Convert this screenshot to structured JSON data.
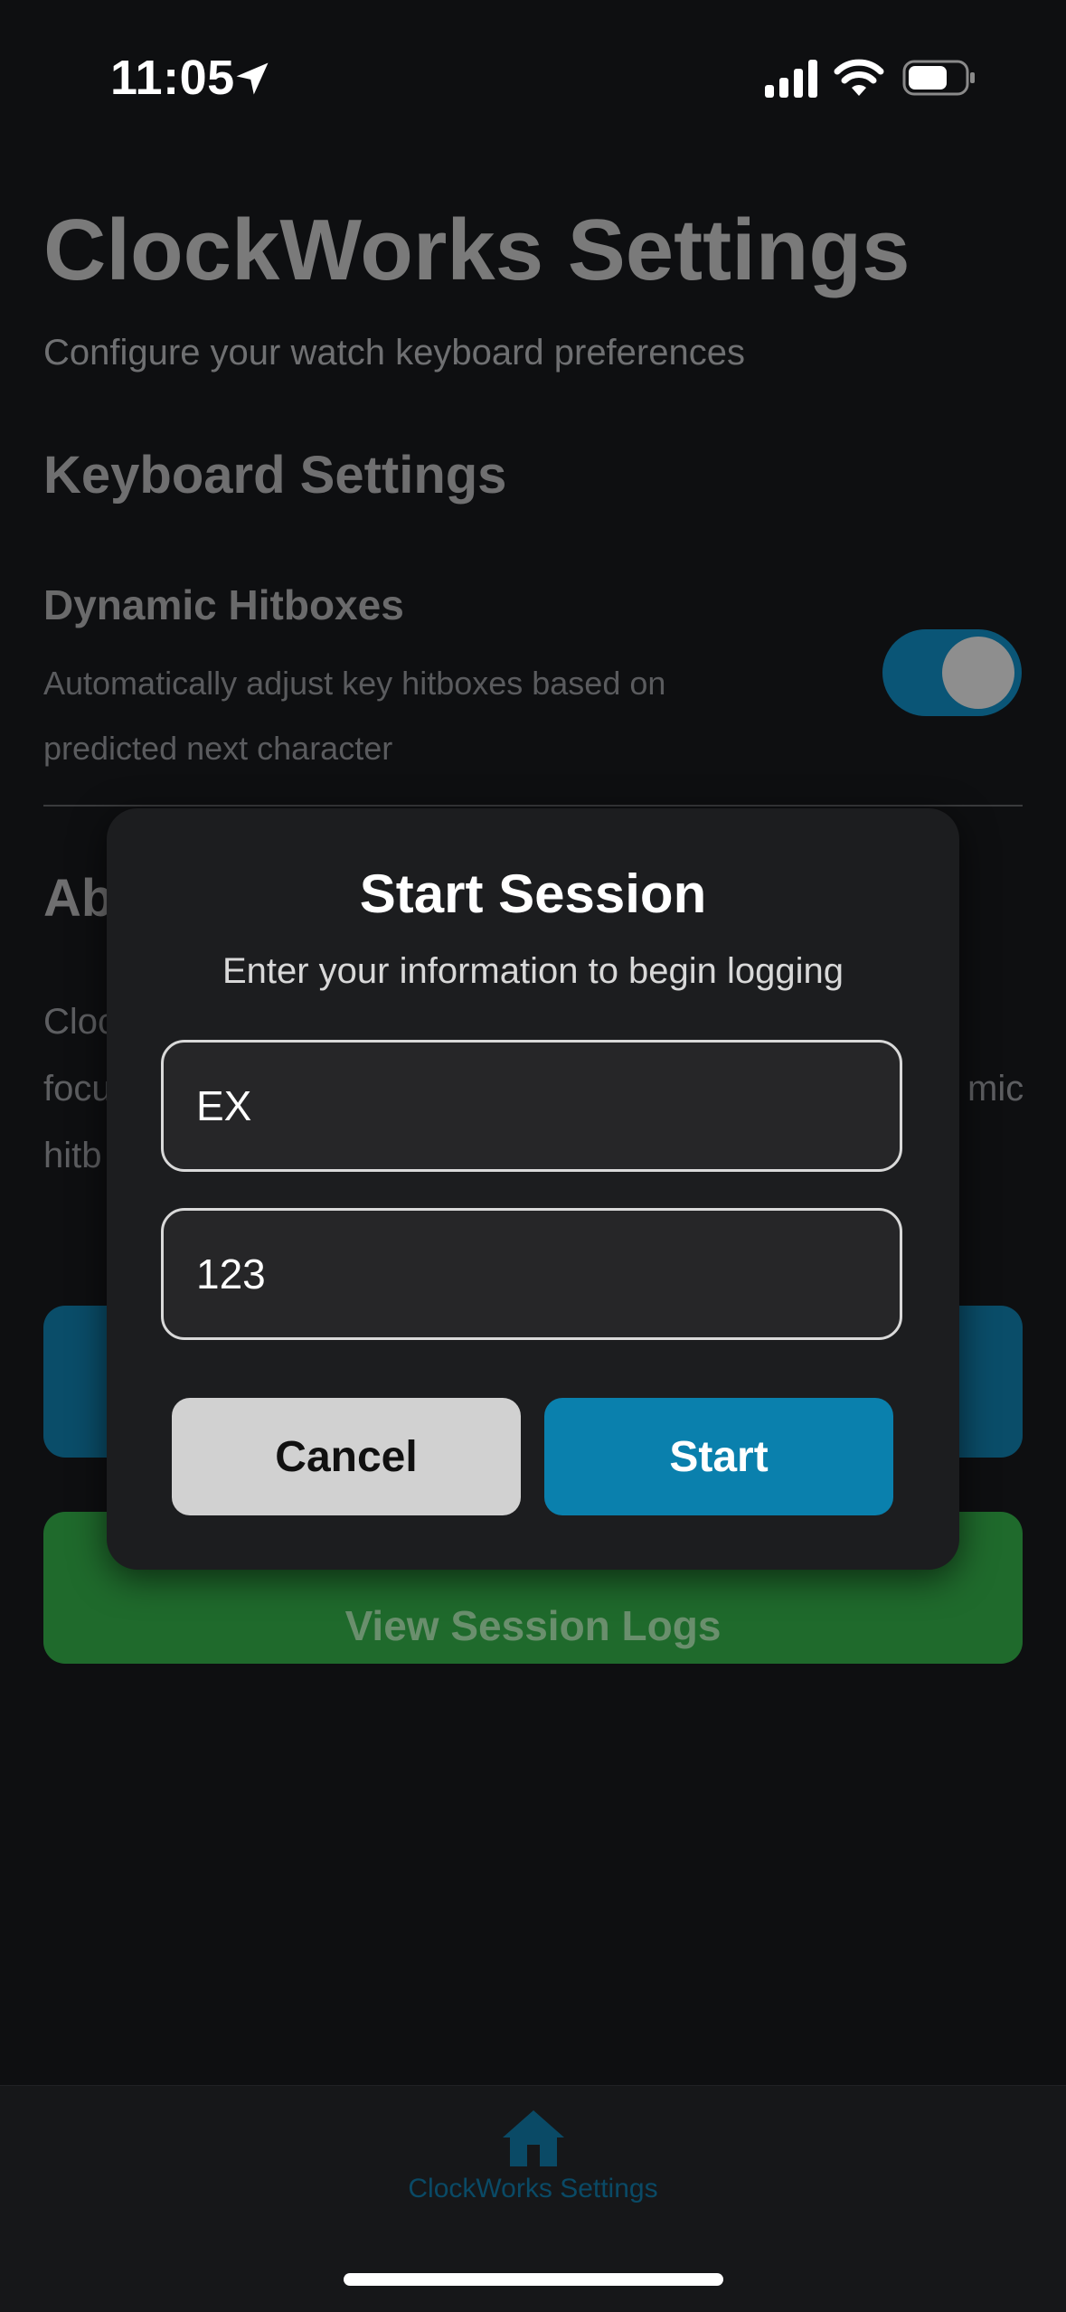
{
  "status_bar": {
    "time": "11:05"
  },
  "page": {
    "title": "ClockWorks Settings",
    "subtitle": "Configure your watch keyboard preferences",
    "keyboard_section": {
      "title": "Keyboard Settings",
      "dynamic_hitboxes": {
        "title": "Dynamic Hitboxes",
        "description": "Automatically adjust key hitboxes based on predicted next character",
        "enabled": true
      }
    },
    "about_section": {
      "title_visible": "Ab",
      "line1_visible": "Cloc",
      "line2_visible": "focu",
      "line2_right_visible": "mic",
      "line3_visible": "hitb"
    },
    "view_logs_label": "View Session Logs"
  },
  "modal": {
    "title": "Start Session",
    "subtitle": "Enter your information to begin logging",
    "name_value": "EX",
    "id_value": "123",
    "cancel_label": "Cancel",
    "start_label": "Start"
  },
  "tab_bar": {
    "items": [
      {
        "label": "ClockWorks Settings",
        "icon": "home-icon",
        "active": true
      }
    ]
  },
  "colors": {
    "accent": "#0a80ad",
    "success": "#1f6a2c",
    "background": "#0e0f11",
    "modal_background": "#1c1d1f"
  }
}
